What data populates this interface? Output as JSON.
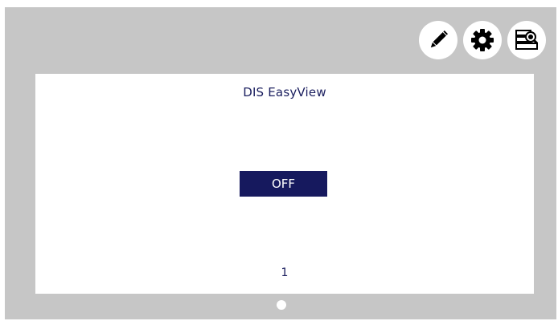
{
  "toolbar": {
    "buttons": [
      {
        "icon": "pencil-icon"
      },
      {
        "icon": "gear-icon"
      },
      {
        "icon": "database-search-icon"
      }
    ]
  },
  "panel": {
    "title": "DIS EasyView",
    "state_button_label": "OFF",
    "page_number": "1"
  },
  "colors": {
    "background": "#c6c6c6",
    "panel": "#ffffff",
    "accent": "#16195e",
    "text": "#1c2060"
  }
}
